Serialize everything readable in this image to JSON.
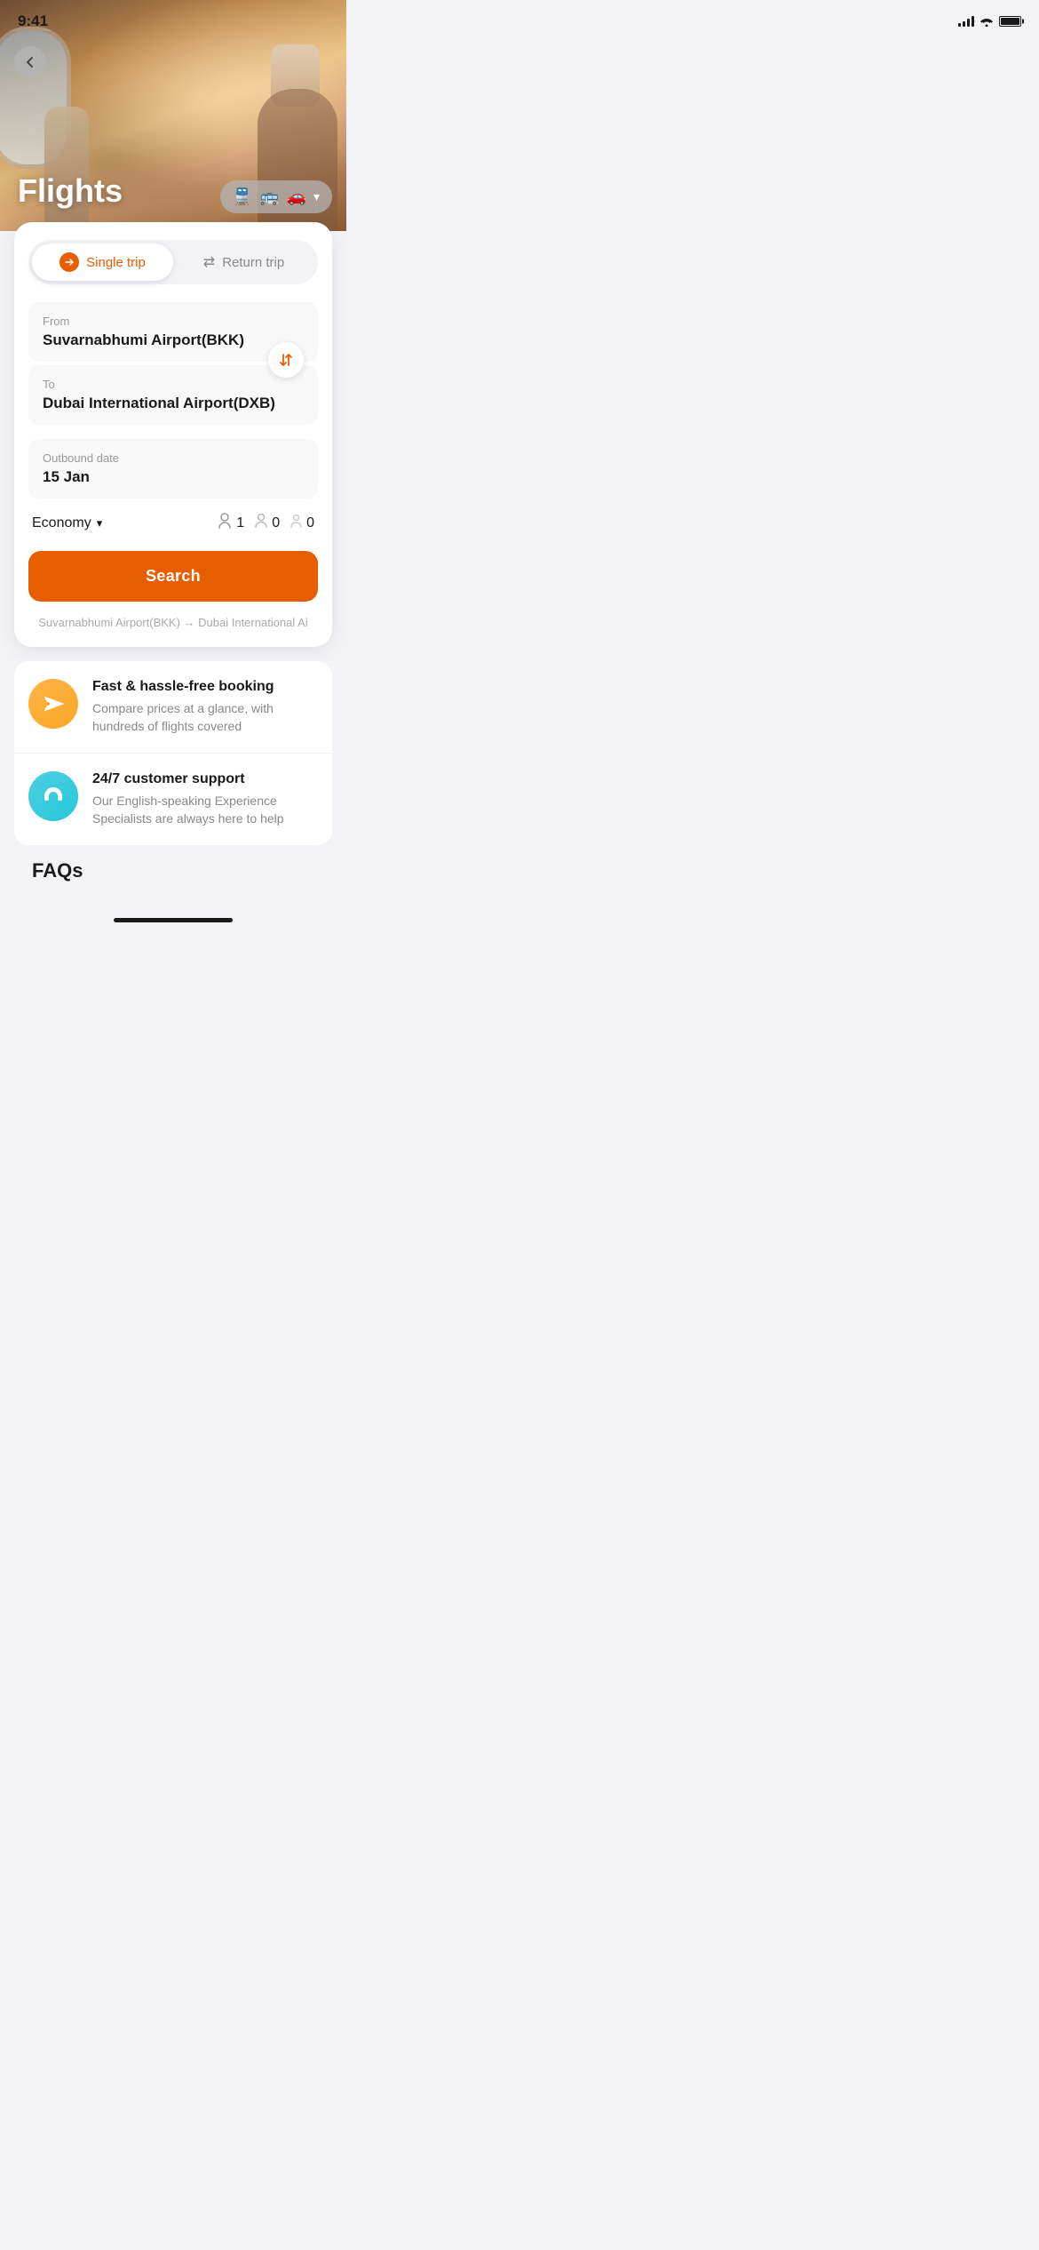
{
  "status_bar": {
    "time": "9:41",
    "signal_bars": 4,
    "wifi": true,
    "battery_full": true
  },
  "header": {
    "title": "Flights",
    "back_label": "‹"
  },
  "transport_selector": {
    "icons": [
      "🚆",
      "🚌",
      "🚗"
    ],
    "chevron": "▾"
  },
  "trip_toggle": {
    "single_trip_label": "Single trip",
    "return_trip_label": "Return trip",
    "active": "single"
  },
  "from_field": {
    "label": "From",
    "value": "Suvarnabhumi Airport(BKK)"
  },
  "to_field": {
    "label": "To",
    "value": "Dubai International Airport(DXB)"
  },
  "date_field": {
    "label": "Outbound date",
    "value": "15 Jan"
  },
  "passengers": {
    "class_label": "Economy",
    "adults": "1",
    "children": "0",
    "infants": "0"
  },
  "search_button": {
    "label": "Search"
  },
  "recent_search": {
    "text": "Suvarnabhumi Airport(BKK) → Dubai International Ai"
  },
  "features": [
    {
      "id": "fast-booking",
      "icon_type": "flight",
      "title": "Fast & hassle-free booking",
      "description": "Compare prices at a glance, with hundreds of flights covered"
    },
    {
      "id": "customer-support",
      "icon_type": "support",
      "title": "24/7 customer support",
      "description": "Our English-speaking Experience Specialists are always here to help"
    }
  ],
  "faqs": {
    "label": "FAQs"
  }
}
